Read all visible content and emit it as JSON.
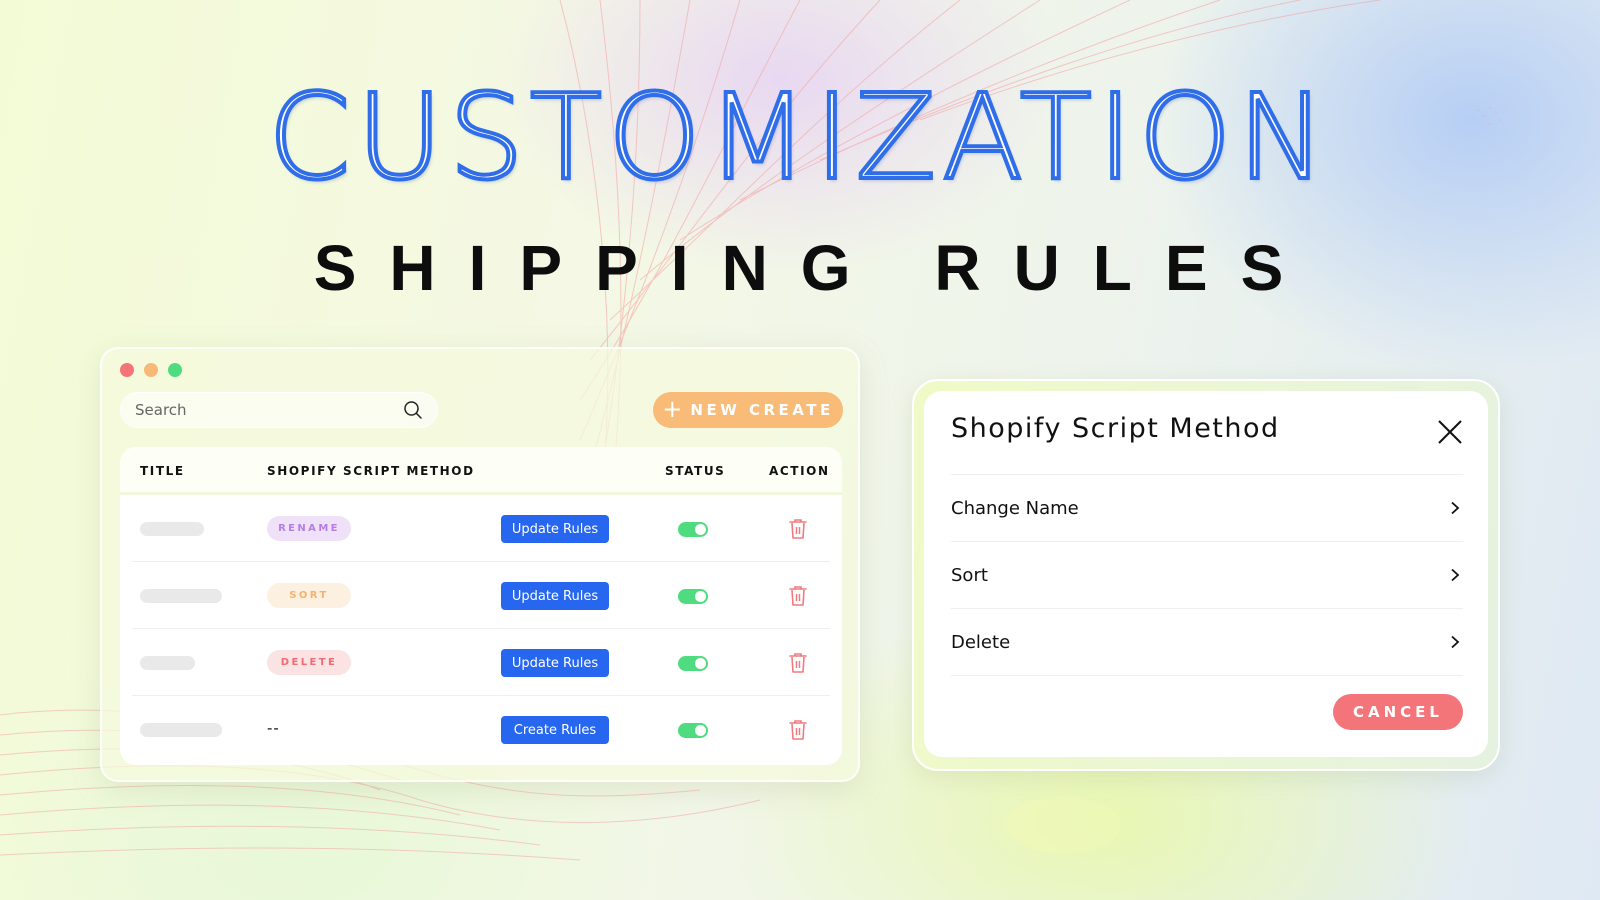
{
  "headline": "CUSTOMIZATION",
  "subheadline": "SHIPPING RULES",
  "colors": {
    "headline_stroke": "#2f6ee8",
    "new_create": "#f8bb78",
    "primary_button": "#2767f0",
    "toggle_on": "#4fdc80",
    "trash": "#f07a7e",
    "cancel": "#f47579",
    "badge_rename": "#b57ee6",
    "badge_sort": "#f5b26e",
    "badge_delete": "#f06c72"
  },
  "app_window": {
    "search": {
      "placeholder": "Search",
      "value": ""
    },
    "new_create_label": "NEW CREATE",
    "table": {
      "headers": {
        "title": "TITLE",
        "method": "SHOPIFY SCRIPT METHOD",
        "status": "STATUS",
        "action": "ACTION"
      },
      "rows": [
        {
          "title": "",
          "method": "RENAME",
          "method_type": "rename",
          "button": "Update Rules",
          "status_on": true,
          "action": "delete-icon"
        },
        {
          "title": "",
          "method": "SORT",
          "method_type": "sort",
          "button": "Update Rules",
          "status_on": true,
          "action": "delete-icon"
        },
        {
          "title": "",
          "method": "DELETE",
          "method_type": "delete",
          "button": "Update Rules",
          "status_on": true,
          "action": "delete-icon"
        },
        {
          "title": "",
          "method": "--",
          "method_type": "none",
          "button": "Create Rules",
          "status_on": true,
          "action": "delete-icon"
        }
      ]
    }
  },
  "modal": {
    "title": "Shopify Script Method",
    "items": [
      {
        "label": "Change Name"
      },
      {
        "label": "Sort"
      },
      {
        "label": "Delete"
      }
    ],
    "cancel_label": "CANCEL"
  }
}
